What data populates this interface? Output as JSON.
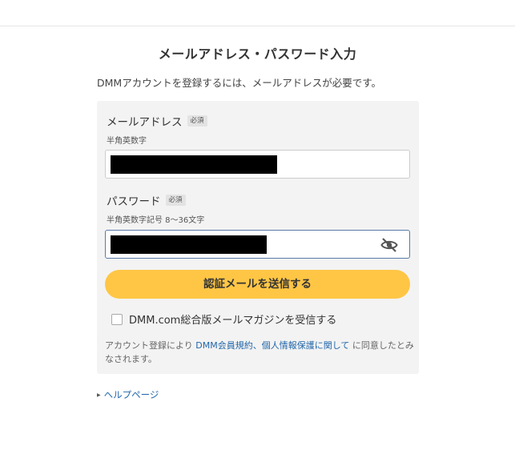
{
  "page": {
    "title": "メールアドレス・パスワード入力",
    "intro": "DMMアカウントを登録するには、メールアドレスが必要です。"
  },
  "form": {
    "email": {
      "label": "メールアドレス",
      "required_badge": "必須",
      "hint": "半角英数字",
      "value_state": "redacted"
    },
    "password": {
      "label": "パスワード",
      "required_badge": "必須",
      "hint": "半角英数字記号 8〜36文字",
      "value_state": "redacted",
      "visibility_icon": "eye-slash-icon"
    },
    "submit_label": "認証メールを送信する",
    "newsletter_label": "DMM.com総合版メールマガジンを受信する",
    "newsletter_checked": false,
    "agreement": {
      "prefix": "アカウント登録により ",
      "terms_link": "DMM会員規約",
      "separator": "、",
      "privacy_link": "個人情報保護に関して",
      "suffix": " に同意したとみなされます。"
    }
  },
  "help": {
    "link_label": "ヘルプページ"
  },
  "colors": {
    "submit_button": "#ffc645",
    "link": "#2266aa",
    "panel_background": "#f3f3f3",
    "focused_border": "#5a7aa8"
  }
}
